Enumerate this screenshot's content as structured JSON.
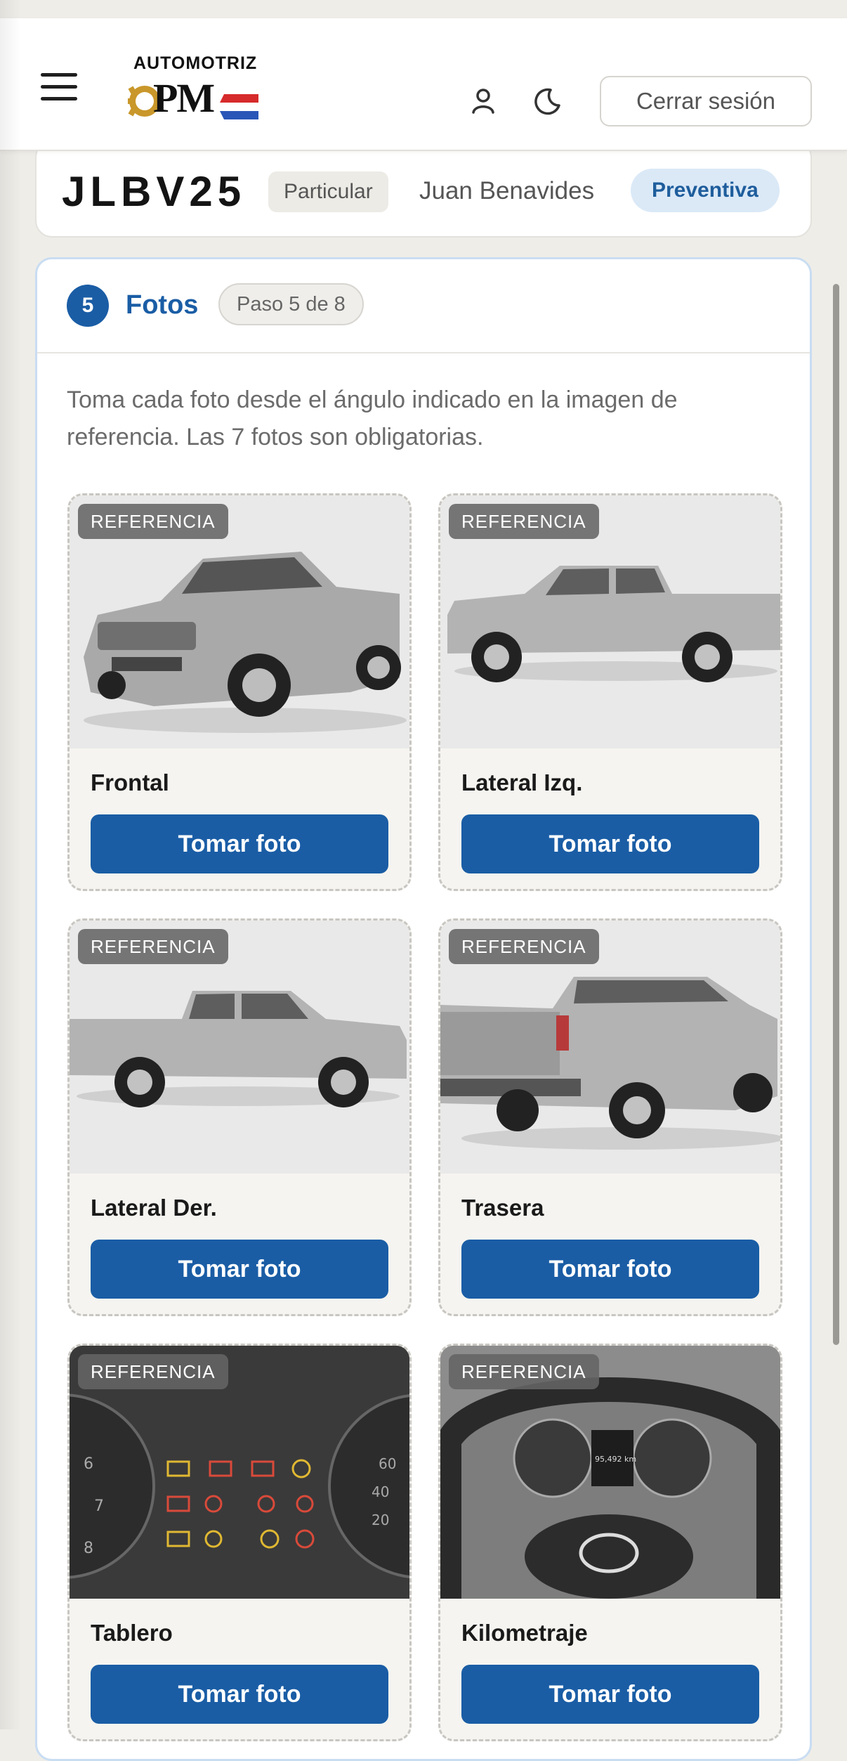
{
  "header": {
    "logo_top_text": "AUTOMOTRIZ",
    "logo_main_text": "PM",
    "logout_label": "Cerrar sesión",
    "icons": [
      "menu-icon",
      "user-icon",
      "moon-icon"
    ]
  },
  "vehicle": {
    "plate": "JLBV25",
    "type": "Particular",
    "owner": "Juan Benavides",
    "service": "Preventiva"
  },
  "step": {
    "number": "5",
    "title": "Fotos",
    "progress": "Paso 5 de 8",
    "description": "Toma cada foto desde el ángulo indicado en la imagen de referencia. Las 7 fotos son obligatorias."
  },
  "photos": [
    {
      "badge": "REFERENCIA",
      "label": "Frontal",
      "button": "Tomar foto"
    },
    {
      "badge": "REFERENCIA",
      "label": "Lateral Izq.",
      "button": "Tomar foto"
    },
    {
      "badge": "REFERENCIA",
      "label": "Lateral Der.",
      "button": "Tomar foto"
    },
    {
      "badge": "REFERENCIA",
      "label": "Trasera",
      "button": "Tomar foto"
    },
    {
      "badge": "REFERENCIA",
      "label": "Tablero",
      "button": "Tomar foto"
    },
    {
      "badge": "REFERENCIA",
      "label": "Kilometraje",
      "button": "Tomar foto"
    }
  ],
  "colors": {
    "primary": "#1a5da5",
    "badge_bg": "#dbe9f7",
    "background": "#efede8",
    "flag_red": "#d62b2b",
    "flag_blue": "#2a56b8",
    "gear_gold": "#c9972a"
  }
}
